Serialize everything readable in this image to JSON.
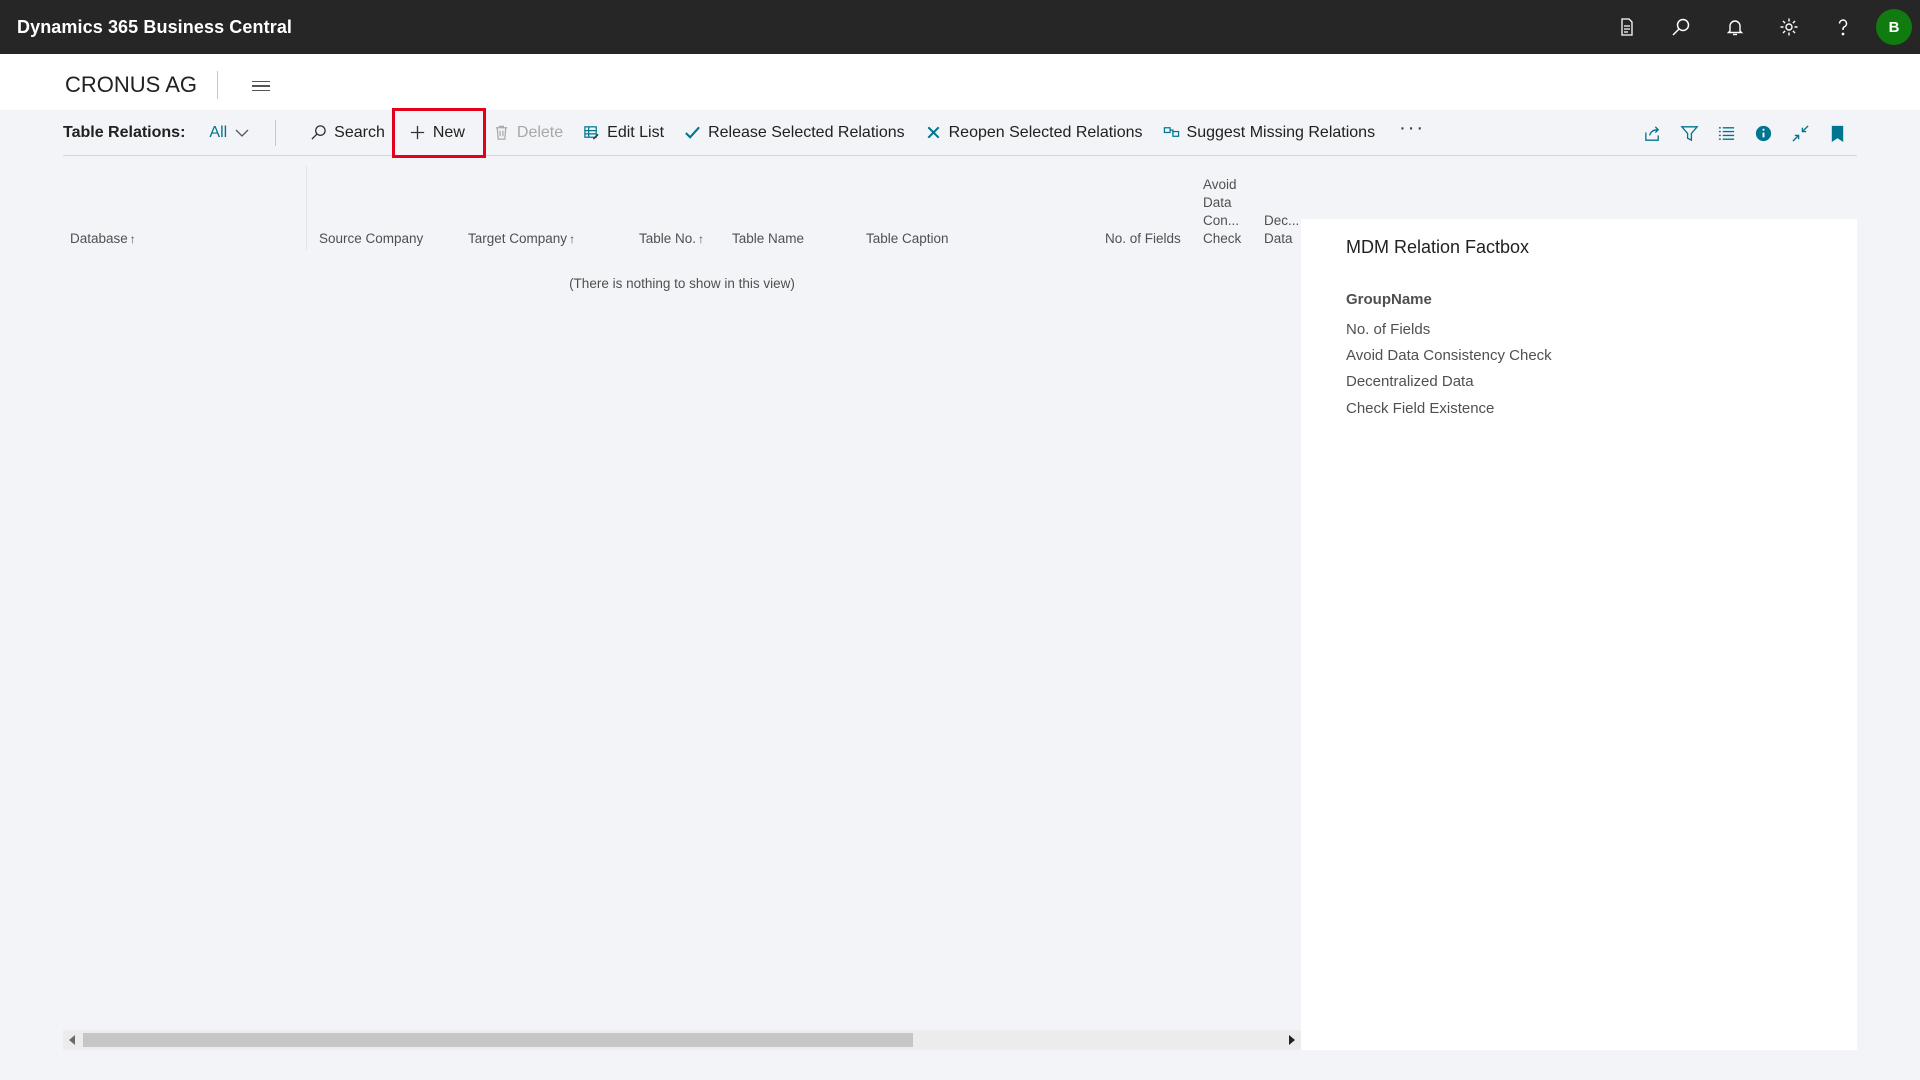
{
  "app": {
    "title": "Dynamics 365 Business Central",
    "user_initial": "B"
  },
  "appbar_icons": [
    "document-icon",
    "search-icon",
    "bell-icon",
    "gear-icon",
    "help-icon"
  ],
  "company": {
    "name": "CRONUS AG"
  },
  "actionbar": {
    "caption": "Table Relations:",
    "view": "All",
    "search_label": "Search",
    "new_label": "New",
    "delete_label": "Delete",
    "edit_list_label": "Edit List",
    "release_label": "Release Selected Relations",
    "reopen_label": "Reopen Selected Relations",
    "suggest_label": "Suggest Missing Relations",
    "more_label": "···"
  },
  "grid": {
    "columns": {
      "database": "Database",
      "source_company": "Source Company",
      "target_company": "Target Company",
      "table_no": "Table No.",
      "table_name": "Table Name",
      "table_caption": "Table Caption",
      "no_of_fields": "No. of Fields",
      "avoid_1": "Avoid",
      "avoid_2": "Data",
      "avoid_3": "Con...",
      "avoid_4": "Check",
      "dec_1": "Dec...",
      "dec_2": "Data"
    },
    "sort_arrow": "↑",
    "empty_message": "(There is nothing to show in this view)"
  },
  "factbox": {
    "title": "MDM Relation Factbox",
    "group": "GroupName",
    "fields": [
      "No. of Fields",
      "Avoid Data Consistency Check",
      "Decentralized Data",
      "Check Field Existence"
    ]
  },
  "colors": {
    "accent": "#00758f",
    "highlight": "#e3001b",
    "avatar": "#107c10",
    "appbar": "#262626"
  }
}
